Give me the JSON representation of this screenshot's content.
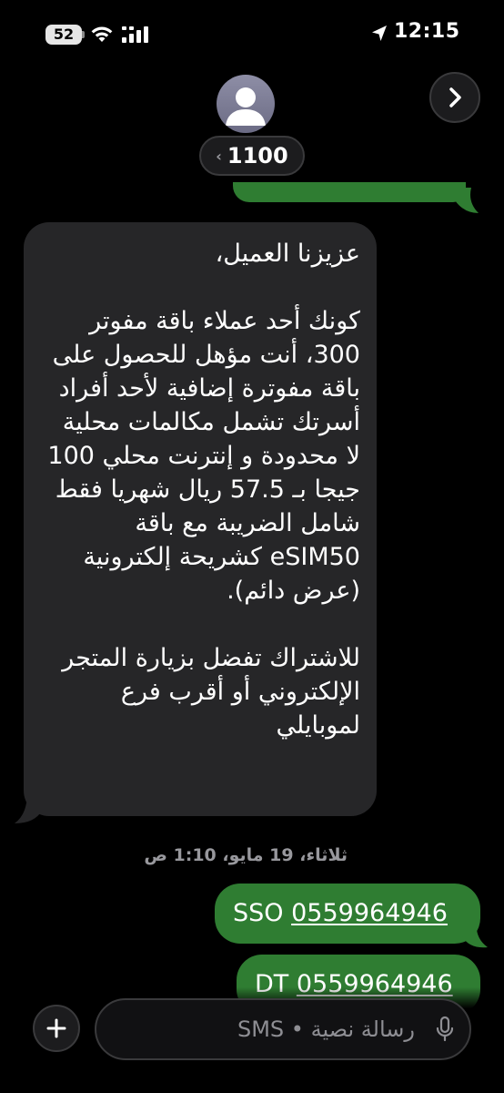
{
  "status_bar": {
    "battery_level": "52",
    "time": "12:15",
    "icons": [
      "battery-icon",
      "wifi-icon",
      "cellular-signal-icon",
      "location-arrow-icon"
    ]
  },
  "header": {
    "contact_name": "1100",
    "contact_chevron": "‹",
    "icons": [
      "avatar-person-icon",
      "chevron-right-icon"
    ]
  },
  "conversation": {
    "received_message": {
      "paragraphs": [
        "عزيزنا العميل،",
        "كونك أحد عملاء باقة مفوتر 300، أنت مؤهل للحصول على باقة مفوترة إضافية لأحد أفراد أسرتك تشمل مكالمات محلية لا محدودة و إنترنت محلي 100 جيجا بـ 57.5 ريال شهريا فقط شامل الضريبة مع باقة eSIM50 كشريحة إلكترونية (عرض دائم).",
        "للاشتراك تفضل بزيارة المتجر الإلكتروني أو أقرب فرع لموبايلي"
      ]
    },
    "timestamp": "ثلاثاء، 19 مايو، 1:10 ص",
    "sent_messages": [
      {
        "prefix": "SSO ",
        "number": "0559964946"
      },
      {
        "prefix": "DT ",
        "number": "0559964946"
      }
    ]
  },
  "composer": {
    "placeholder": "رسالة نصية • SMS",
    "value": "",
    "icons": [
      "plus-icon",
      "microphone-icon"
    ]
  },
  "colors": {
    "background": "#000000",
    "received_bubble": "#262628",
    "sent_bubble": "#2f7d32",
    "secondary_text": "#98989d"
  }
}
